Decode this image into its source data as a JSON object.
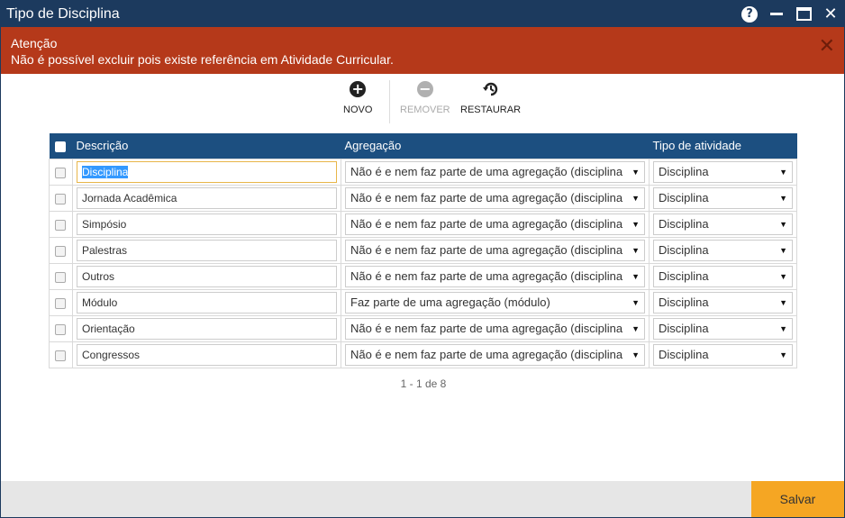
{
  "window": {
    "title": "Tipo de Disciplina"
  },
  "alert": {
    "title": "Atenção",
    "message": "Não é possível excluir pois existe referência em Atividade Curricular."
  },
  "toolbar": {
    "new_label": "NOVO",
    "remove_label": "REMOVER",
    "restore_label": "RESTAURAR"
  },
  "table": {
    "headers": {
      "descricao": "Descrição",
      "agregacao": "Agregação",
      "tipo": "Tipo de atividade"
    },
    "rows": [
      {
        "descricao": "Disciplina",
        "agregacao": "Não é e nem faz parte de uma agregação (disciplina",
        "tipo": "Disciplina"
      },
      {
        "descricao": "Jornada Acadêmica",
        "agregacao": "Não é e nem faz parte de uma agregação (disciplina",
        "tipo": "Disciplina"
      },
      {
        "descricao": "Simpósio",
        "agregacao": "Não é e nem faz parte de uma agregação (disciplina",
        "tipo": "Disciplina"
      },
      {
        "descricao": "Palestras",
        "agregacao": "Não é e nem faz parte de uma agregação (disciplina",
        "tipo": "Disciplina"
      },
      {
        "descricao": "Outros",
        "agregacao": "Não é e nem faz parte de uma agregação (disciplina",
        "tipo": "Disciplina"
      },
      {
        "descricao": "Módulo",
        "agregacao": "Faz parte de uma agregação (módulo)",
        "tipo": "Disciplina"
      },
      {
        "descricao": "Orientação",
        "agregacao": "Não é e nem faz parte de uma agregação (disciplina",
        "tipo": "Disciplina"
      },
      {
        "descricao": "Congressos",
        "agregacao": "Não é e nem faz parte de uma agregação (disciplina",
        "tipo": "Disciplina"
      }
    ]
  },
  "pager": {
    "text": "1 - 1 de 8"
  },
  "footer": {
    "save_label": "Salvar"
  },
  "colors": {
    "titlebar": "#1c3a5e",
    "alert": "#b5391a",
    "header": "#1c4f80",
    "save": "#f5a623"
  }
}
